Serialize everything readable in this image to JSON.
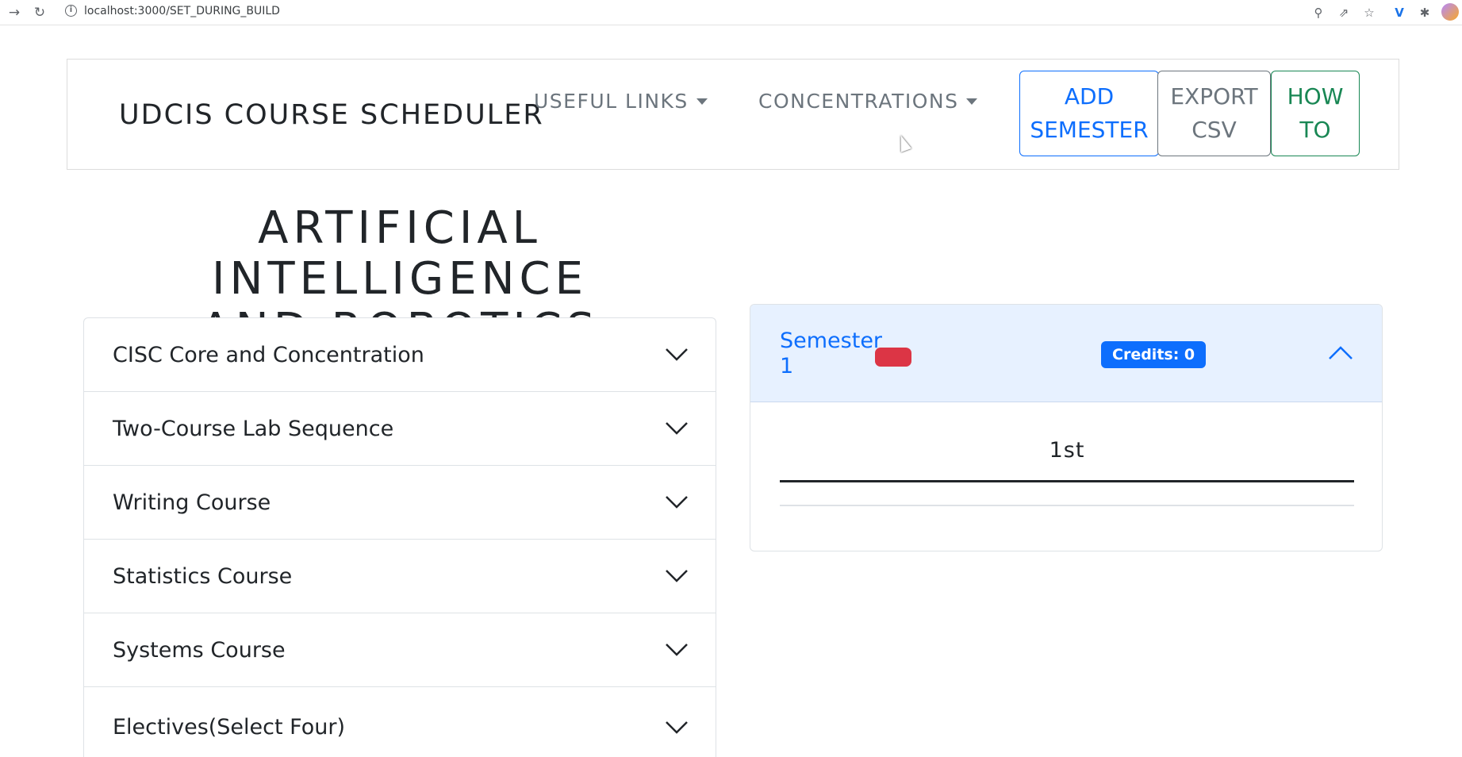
{
  "browser": {
    "url": "localhost:3000/SET_DURING_BUILD"
  },
  "navbar": {
    "brand": "UDCIS COURSE SCHEDULER",
    "useful_links": "USEFUL LINKS",
    "concentrations": "CONCENTRATIONS",
    "add_semester_line1": "ADD",
    "add_semester_line2": "SEMESTER",
    "export_csv_line1": "EXPORT",
    "export_csv_line2": "CSV",
    "how_to_line1": "HOW",
    "how_to_line2": "TO"
  },
  "page": {
    "title_line1": "ARTIFICIAL INTELLIGENCE",
    "title_line2": "AND ROBOTICS"
  },
  "requirements": [
    {
      "label": "CISC Core and Concentration"
    },
    {
      "label": "Two-Course Lab Sequence"
    },
    {
      "label": "Writing Course"
    },
    {
      "label": "Statistics Course"
    },
    {
      "label": "Systems Course"
    },
    {
      "label": "Electives(Select Four)"
    }
  ],
  "semester": {
    "name_line1": "Semester",
    "name_line2": "1",
    "credits": "Credits: 0",
    "body_label": "1st"
  },
  "colors": {
    "primary": "#0d6efd",
    "secondary": "#6c757d",
    "success": "#198754",
    "danger": "#dc3545",
    "header_bg": "#e7f1ff"
  },
  "icons": {
    "back": "arrow-right-icon",
    "reload": "reload-icon",
    "site_info": "info-icon",
    "zoom": "zoom-icon",
    "share": "share-icon",
    "bookmark": "star-icon",
    "extension_v": "v-extension-icon",
    "extensions": "puzzle-icon",
    "profile": "avatar"
  }
}
